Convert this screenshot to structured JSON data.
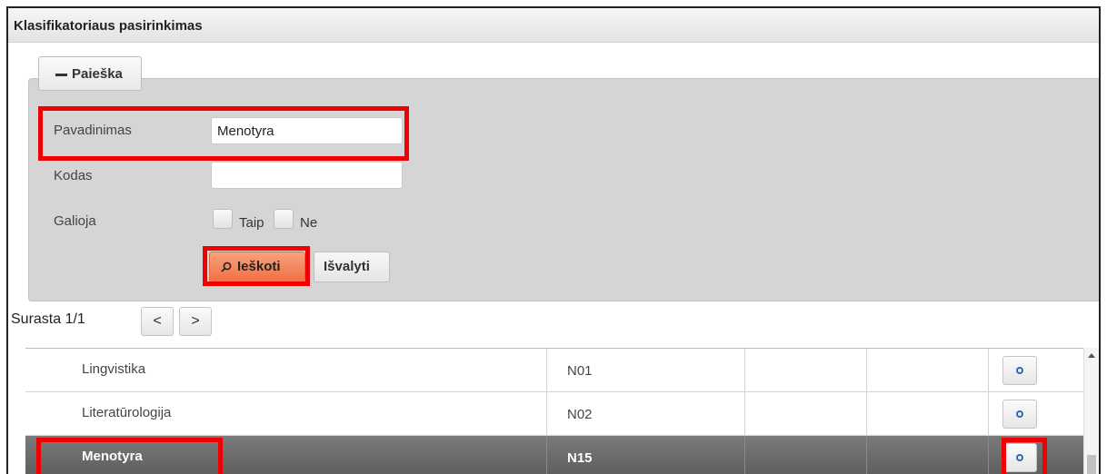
{
  "window": {
    "title": "Klasifikatoriaus pasirinkimas"
  },
  "search": {
    "toggle_label": "Paieška",
    "name_label": "Pavadinimas",
    "name_value": "Menotyra",
    "code_label": "Kodas",
    "code_value": "",
    "valid_label": "Galioja",
    "opt_yes": "Taip",
    "opt_no": "Ne",
    "search_button": "Ieškoti",
    "clear_button": "Išvalyti"
  },
  "pager": {
    "label": "Surasta 1/1",
    "prev": "<",
    "next": ">"
  },
  "rows": [
    {
      "name": "Lingvistika",
      "code": "N01",
      "selected": false
    },
    {
      "name": "Literatūrologija",
      "code": "N02",
      "selected": false
    },
    {
      "name": "Menotyra",
      "code": "N15",
      "selected": true
    }
  ],
  "colors": {
    "highlight": "#f00000",
    "search_button": "#f07042",
    "selected_row": "#6a6a6a"
  },
  "icons": {
    "search": "magnifier-icon",
    "select": "radio-circle-icon",
    "toggle": "minus-icon"
  }
}
